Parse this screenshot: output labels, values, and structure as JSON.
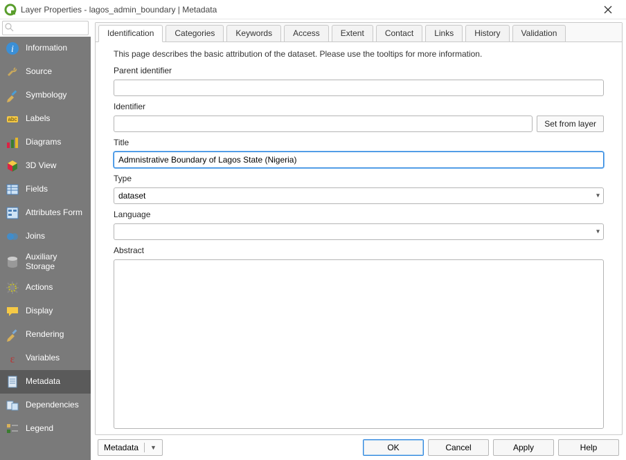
{
  "window": {
    "title": "Layer Properties - lagos_admin_boundary | Metadata"
  },
  "sidebar": {
    "search_placeholder": "",
    "items": [
      {
        "label": "Information",
        "icon": "info-icon"
      },
      {
        "label": "Source",
        "icon": "wrench-icon"
      },
      {
        "label": "Symbology",
        "icon": "paintbrush-icon"
      },
      {
        "label": "Labels",
        "icon": "label-icon"
      },
      {
        "label": "Diagrams",
        "icon": "diagrams-icon"
      },
      {
        "label": "3D View",
        "icon": "cube-icon"
      },
      {
        "label": "Fields",
        "icon": "fields-icon"
      },
      {
        "label": "Attributes Form",
        "icon": "form-icon"
      },
      {
        "label": "Joins",
        "icon": "joins-icon"
      },
      {
        "label": "Auxiliary Storage",
        "icon": "db-icon"
      },
      {
        "label": "Actions",
        "icon": "gear-icon"
      },
      {
        "label": "Display",
        "icon": "speech-icon"
      },
      {
        "label": "Rendering",
        "icon": "render-icon"
      },
      {
        "label": "Variables",
        "icon": "epsilon-icon"
      },
      {
        "label": "Metadata",
        "icon": "sheet-icon"
      },
      {
        "label": "Dependencies",
        "icon": "deps-icon"
      },
      {
        "label": "Legend",
        "icon": "legend-icon"
      }
    ],
    "selected_index": 14
  },
  "tabs": {
    "items": [
      "Identification",
      "Categories",
      "Keywords",
      "Access",
      "Extent",
      "Contact",
      "Links",
      "History",
      "Validation"
    ],
    "active_index": 0
  },
  "identification": {
    "description": "This page describes the basic attribution of the dataset. Please use the tooltips for more information.",
    "labels": {
      "parent_identifier": "Parent identifier",
      "identifier": "Identifier",
      "title": "Title",
      "type": "Type",
      "language": "Language",
      "abstract": "Abstract"
    },
    "values": {
      "parent_identifier": "",
      "identifier": "",
      "title": "Admnistrative Boundary of Lagos State (Nigeria)",
      "type": "dataset",
      "language": "",
      "abstract": ""
    },
    "buttons": {
      "set_from_layer": "Set from layer"
    }
  },
  "footer": {
    "style_menu": "Metadata",
    "ok": "OK",
    "cancel": "Cancel",
    "apply": "Apply",
    "help": "Help"
  }
}
